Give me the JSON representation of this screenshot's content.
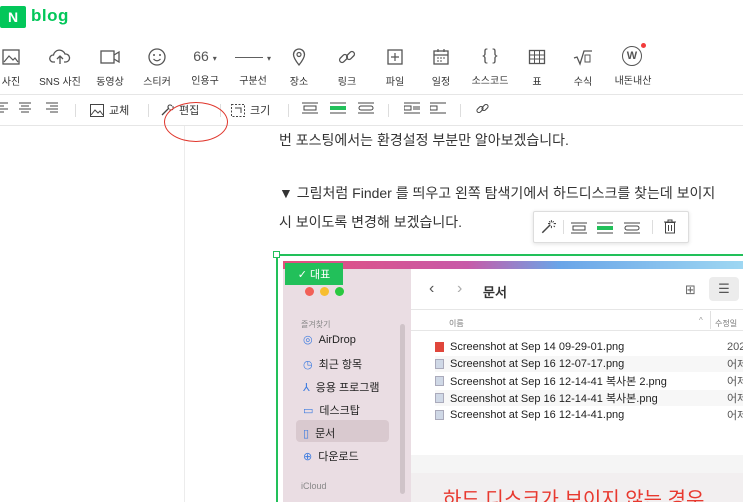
{
  "header": {
    "logo_letter": "N",
    "logo_text": "blog"
  },
  "toolbar": [
    {
      "name": "photo",
      "label": "사진"
    },
    {
      "name": "sns-photo",
      "label": "SNS 사진"
    },
    {
      "name": "video",
      "label": "동영상"
    },
    {
      "name": "sticker",
      "label": "스티커"
    },
    {
      "name": "quote",
      "label": "인용구",
      "glyph": "66"
    },
    {
      "name": "divider",
      "label": "구분선",
      "glyph": "—"
    },
    {
      "name": "place",
      "label": "장소"
    },
    {
      "name": "link",
      "label": "링크"
    },
    {
      "name": "file",
      "label": "파일"
    },
    {
      "name": "schedule",
      "label": "일정"
    },
    {
      "name": "source-code",
      "label": "소스코드",
      "glyph": "{ }"
    },
    {
      "name": "table",
      "label": "표"
    },
    {
      "name": "formula",
      "label": "수식"
    },
    {
      "name": "my-market",
      "label": "내돈내산",
      "glyph": "W"
    }
  ],
  "image_toolbar": {
    "replace_label": "교체",
    "edit_label": "편집",
    "size_label": "크기"
  },
  "editor": {
    "line1": "번 포스팅에서는 환경설정 부분만 알아보겠습니다.",
    "line2": "▼ 그림처럼 Finder 를 띄우고 왼쪽 탐색기에서 하드디스크를 찾는데 보이지",
    "line3": "시 보이도록 변경해 보겠습니다."
  },
  "screenshot": {
    "badge": "✓ 대표",
    "folder_title": "문서",
    "sidebar_header": "즐겨찾기",
    "sidebar_items": [
      "AirDrop",
      "최근 항목",
      "응용 프로그램",
      "데스크탑",
      "문서",
      "다운로드"
    ],
    "sidebar_footer": "iCloud",
    "col_name": "이름",
    "col_modified": "수정일",
    "files": [
      {
        "name": "Screenshot at Sep 14 09-29-01.png",
        "date": "202"
      },
      {
        "name": "Screenshot at Sep 16 12-07-17.png",
        "date": "어제"
      },
      {
        "name": "Screenshot at Sep 16 12-14-41 복사본 2.png",
        "date": "어제"
      },
      {
        "name": "Screenshot at Sep 16 12-14-41 복사본.png",
        "date": "어제"
      },
      {
        "name": "Screenshot at Sep 16 12-14-41.png",
        "date": "어제"
      }
    ],
    "caption": "하드 디스크가 보이지 않는 경우"
  },
  "colors": {
    "brand": "#03c75a",
    "selection": "#22c05a",
    "annotation": "#e0362c",
    "caption": "#e8392f"
  }
}
